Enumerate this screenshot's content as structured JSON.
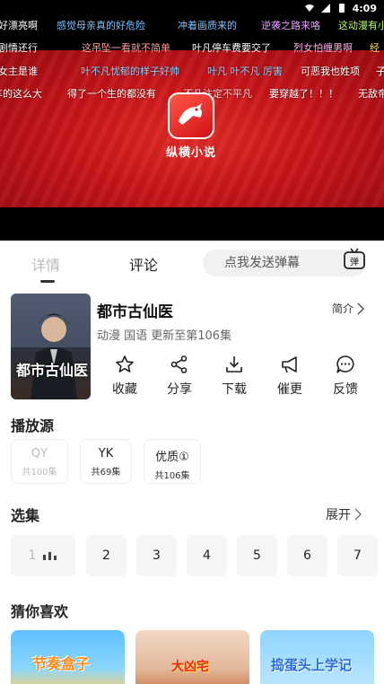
{
  "status": {
    "time": "4:09"
  },
  "video": {
    "logo_text": "纵横小说",
    "danmaku": [
      [
        "好漂亮啊",
        "感觉母亲真的好危险",
        "冲着画质来的",
        "逆袭之路来咯",
        "这动漫有小"
      ],
      [
        "剧情还行",
        "这吊坠一看就不简单",
        "叶凡停车费要交了",
        "烈女怕缠男啊",
        "经"
      ],
      [
        "女主是谁",
        "叶不凡忧郁的样子好帅",
        "叶凡 叶不凡 厉害",
        "可恶我也姓项",
        "子"
      ],
      [
        "车的这么大",
        "得了一个生的都没有",
        "不凡注定不平凡",
        "要穿越了！！！",
        "无敌帝"
      ]
    ]
  },
  "tabs": {
    "detail": "详情",
    "comment": "评论",
    "danmaku_placeholder": "点我发送弹幕",
    "danmaku_toggle": "弹"
  },
  "show": {
    "title": "都市古仙医",
    "intro": "简介",
    "meta": "动漫 国语 更新至第106集",
    "cover_text": "都市古仙医"
  },
  "actions": [
    {
      "label": "收藏",
      "icon": "star-icon"
    },
    {
      "label": "分享",
      "icon": "share-icon"
    },
    {
      "label": "下载",
      "icon": "download-icon"
    },
    {
      "label": "催更",
      "icon": "megaphone-icon"
    },
    {
      "label": "反馈",
      "icon": "chat-icon"
    }
  ],
  "sources": {
    "title": "播放源",
    "items": [
      {
        "name": "QY",
        "count": "共100集",
        "enabled": false
      },
      {
        "name": "YK",
        "count": "共69集",
        "enabled": true
      },
      {
        "name": "优质①",
        "count": "共106集",
        "enabled": true
      }
    ]
  },
  "episodes": {
    "title": "选集",
    "expand": "展开",
    "items": [
      "1",
      "2",
      "3",
      "4",
      "5",
      "6",
      "7"
    ]
  },
  "recommend": {
    "title": "猜你喜欢",
    "items": [
      "节奏盒子",
      "大凶宅",
      "捣蛋头上学记"
    ]
  },
  "colors": {
    "accent": "#c8151a",
    "danmaku_blue": "#6fb7ff",
    "danmaku_yellow": "#ffe14a",
    "danmaku_green": "#9be84a"
  }
}
